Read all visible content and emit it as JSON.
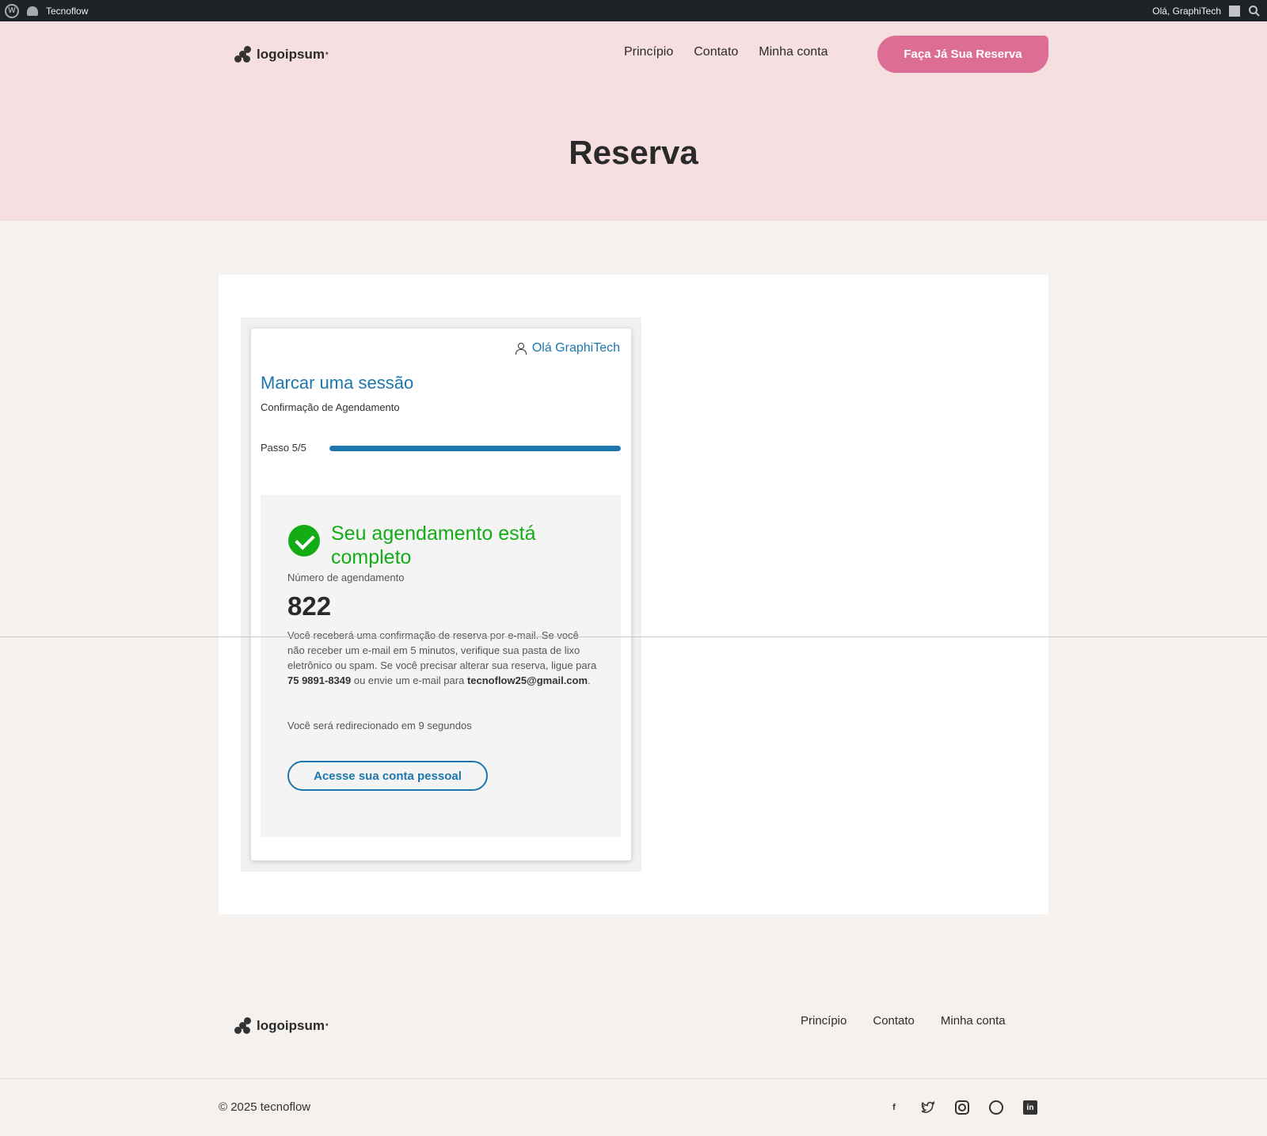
{
  "admin_bar": {
    "site_name": "Tecnoflow",
    "greeting": "Olá, GraphiTech"
  },
  "header": {
    "logo_text": "logoipsum",
    "logo_sup": "*",
    "nav": [
      "Princípio",
      "Contato",
      "Minha conta"
    ],
    "cta_label": "Faça Já Sua Reserva",
    "page_title": "Reserva"
  },
  "widget": {
    "user_greeting": "Olá GraphiTech",
    "title": "Marcar uma sessão",
    "subtitle": "Confirmação de Agendamento",
    "step_label": "Passo 5/5",
    "progress": 1.0,
    "done_title": "Seu agendamento está completo",
    "number_label": "Número de agendamento",
    "number_value": "822",
    "info_1": "Você receberá uma confirmação de reserva por e-mail. Se você não receber um e-mail em 5 minutos, verifique sua pasta de lixo eletrônico ou spam. Se você precisar alterar sua reserva, ligue para ",
    "phone": "75 9891-8349",
    "info_2": " ou envie um e-mail para ",
    "email": "tecnoflow25@gmail.com",
    "info_3": ".",
    "redirect": "Você será redirecionado em 9 segundos",
    "account_button": "Acesse sua conta pessoal"
  },
  "footer": {
    "logo_text": "logoipsum",
    "logo_sup": "*",
    "nav": [
      "Princípio",
      "Contato",
      "Minha conta"
    ],
    "copyright": "© 2025 tecnoflow",
    "social_icons": [
      "facebook-icon",
      "twitter-icon",
      "instagram-icon",
      "whatsapp-icon",
      "linkedin-icon"
    ]
  },
  "colors": {
    "accent": "#1c77ae",
    "success": "#14ac16",
    "cta": "#dc6d94",
    "header_bg": "#f6dfe0",
    "page_bg": "#f5f1ef"
  }
}
